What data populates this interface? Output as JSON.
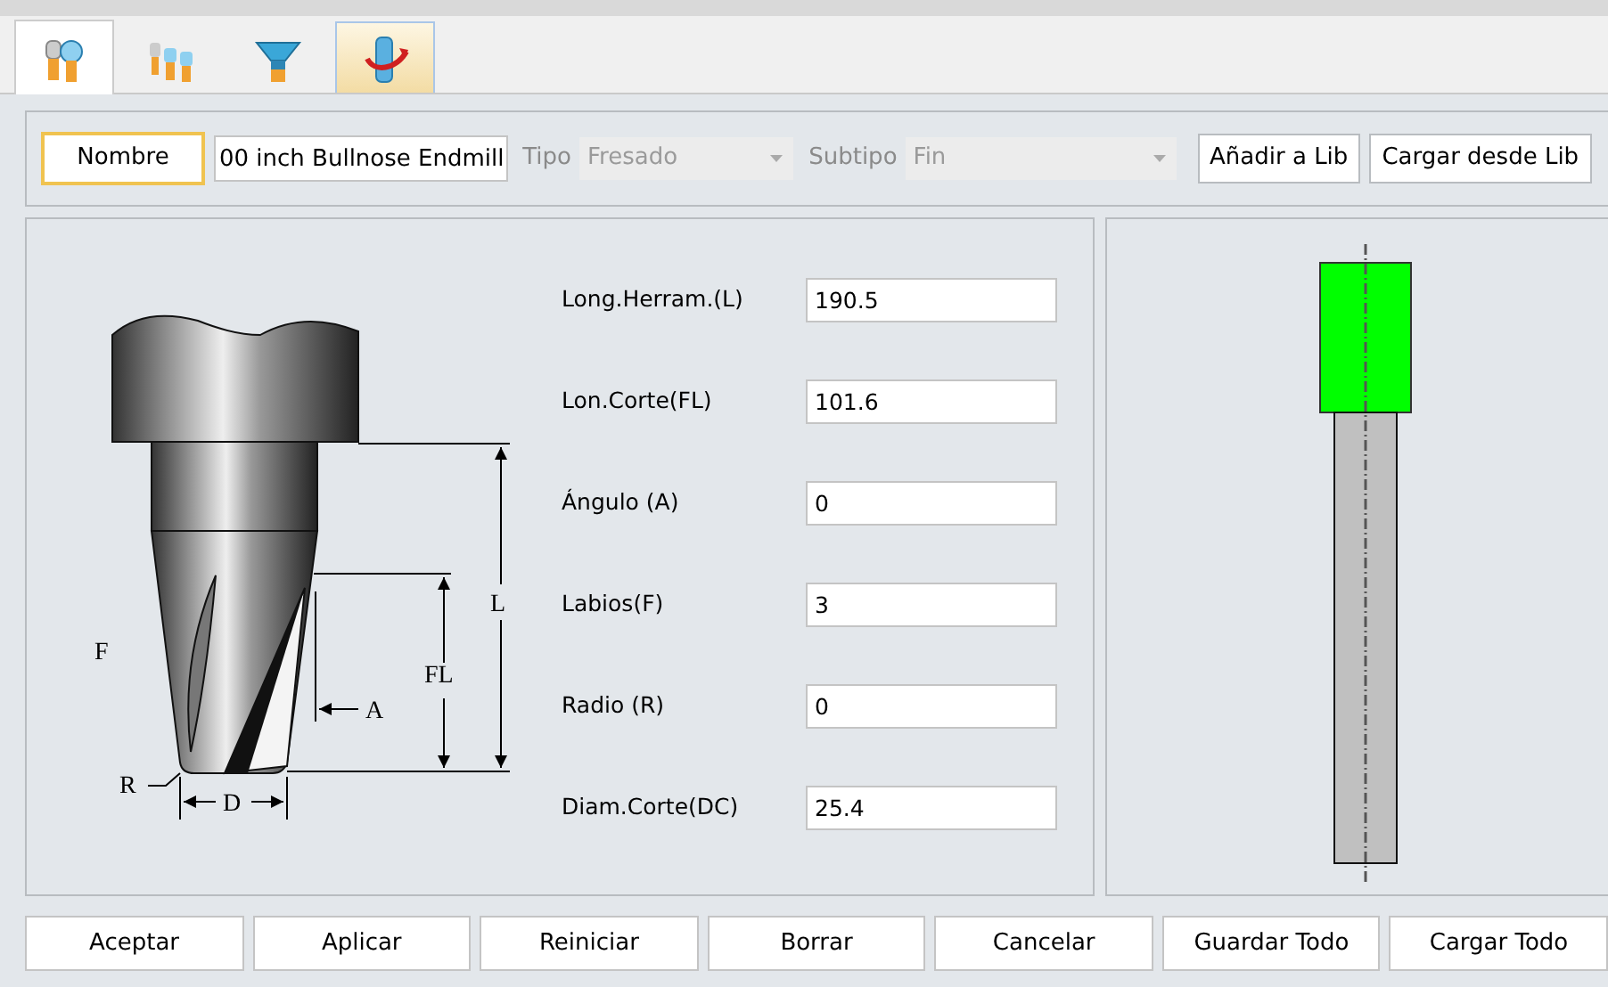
{
  "tabs": [
    {
      "selected": true,
      "hovered": false
    },
    {
      "selected": false,
      "hovered": false
    },
    {
      "selected": false,
      "hovered": false
    },
    {
      "selected": false,
      "hovered": true
    }
  ],
  "toolbar": {
    "name_button": "Nombre",
    "name_value": "00 inch Bullnose Endmill",
    "type_label": "Tipo",
    "type_value": "Fresado",
    "type_disabled": true,
    "subtype_label": "Subtipo",
    "subtype_value": "Fin",
    "subtype_disabled": true,
    "buttons": [
      "Añadir a Lib",
      "Cargar desde Lib"
    ]
  },
  "diagram": {
    "labels": {
      "flutes": "F",
      "radius": "R",
      "diameter": "D",
      "angle": "A",
      "flute_length": "FL",
      "length": "L"
    }
  },
  "parameters": [
    {
      "label": "Long.Herram.(L)",
      "value": "190.5"
    },
    {
      "label": "Lon.Corte(FL)",
      "value": "101.6"
    },
    {
      "label": "Ángulo (A)",
      "value": "0"
    },
    {
      "label": "Labios(F)",
      "value": "3"
    },
    {
      "label": "Radio (R)",
      "value": "0"
    },
    {
      "label": "Diam.Corte(DC)",
      "value": "25.4"
    }
  ],
  "buttons": [
    "Aceptar",
    "Aplicar",
    "Reiniciar",
    "Borrar",
    "Cancelar",
    "Guardar Todo",
    "Cargar Todo"
  ]
}
